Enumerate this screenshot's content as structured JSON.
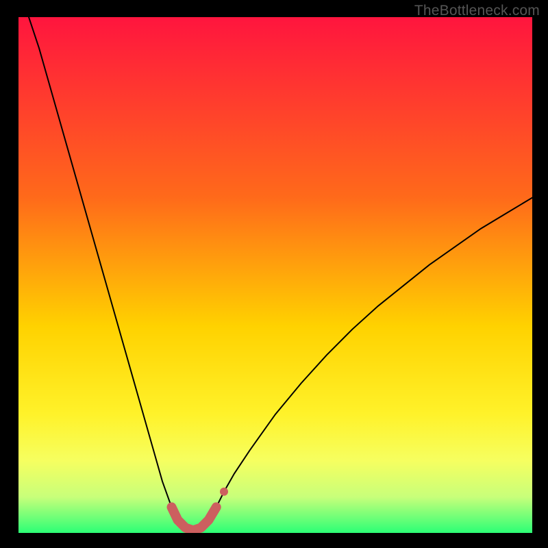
{
  "attribution": "TheBottleneck.com",
  "colors": {
    "frame": "#000000",
    "grad_top": "#ff153e",
    "grad_mid1": "#ff6a1a",
    "grad_mid2": "#ffd200",
    "grad_mid3": "#fff22a",
    "grad_mid4": "#f6ff60",
    "grad_bot1": "#c8ff7a",
    "grad_bot2": "#2cff76",
    "curve": "#000000",
    "marker_fill": "#cc5f5f",
    "marker_stroke": "#cc5f5f"
  },
  "chart_data": {
    "type": "line",
    "title": "",
    "xlabel": "",
    "ylabel": "",
    "xlim": [
      0,
      100
    ],
    "ylim": [
      0,
      100
    ],
    "series": [
      {
        "name": "bottleneck-curve",
        "x": [
          2,
          4,
          6,
          8,
          10,
          12,
          14,
          16,
          18,
          20,
          22,
          24,
          26,
          28,
          29.8,
          31,
          32.5,
          34,
          35.5,
          37,
          38.5,
          40,
          42,
          45,
          50,
          55,
          60,
          65,
          70,
          75,
          80,
          85,
          90,
          95,
          100
        ],
        "y": [
          100,
          94,
          87,
          80,
          73,
          66,
          59,
          52,
          45,
          38,
          31,
          24,
          17,
          10,
          5,
          2.5,
          1,
          0.5,
          1,
          2.5,
          5,
          8,
          11.5,
          16,
          23,
          29,
          34.5,
          39.5,
          44,
          48,
          52,
          55.5,
          59,
          62,
          65
        ]
      }
    ],
    "markers": {
      "name": "highlight-band",
      "x": [
        29.8,
        31,
        32.5,
        34,
        35.5,
        37,
        38.5
      ],
      "y": [
        5,
        2.5,
        1,
        0.5,
        1,
        2.5,
        5
      ],
      "extra_point": {
        "x": 40,
        "y": 8
      }
    },
    "gradient_stops": [
      {
        "offset": 0.0,
        "key": "grad_top"
      },
      {
        "offset": 0.35,
        "key": "grad_mid1"
      },
      {
        "offset": 0.6,
        "key": "grad_mid2"
      },
      {
        "offset": 0.77,
        "key": "grad_mid3"
      },
      {
        "offset": 0.86,
        "key": "grad_mid4"
      },
      {
        "offset": 0.93,
        "key": "grad_bot1"
      },
      {
        "offset": 1.0,
        "key": "grad_bot2"
      }
    ]
  }
}
